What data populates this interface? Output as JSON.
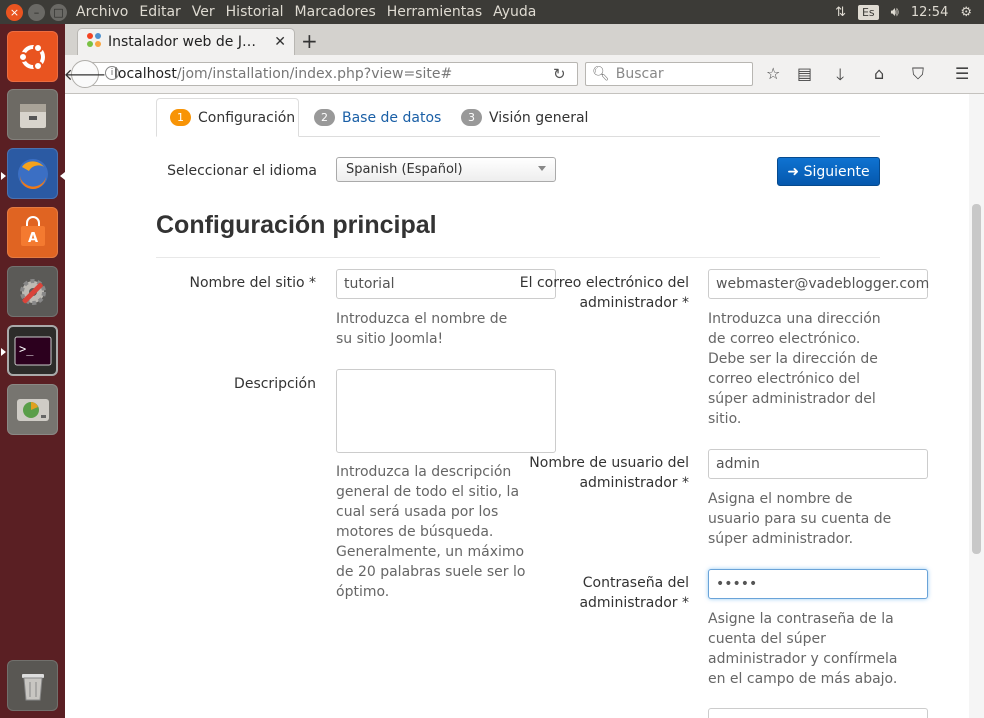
{
  "top_panel": {
    "menu": [
      "Archivo",
      "Editar",
      "Ver",
      "Historial",
      "Marcadores",
      "Herramientas",
      "Ayuda"
    ],
    "language": "Es",
    "time": "12:54",
    "close_glyph": "×",
    "minimize_glyph": "–",
    "maximize_glyph": "□"
  },
  "launcher": {
    "items": [
      "ubuntu-icon",
      "files-icon",
      "firefox-icon",
      "software-center-icon",
      "settings-icon",
      "terminal-icon",
      "disk-icon",
      "trash-icon"
    ]
  },
  "browser": {
    "tab_title": "Instalador web de J…",
    "new_tab": "+",
    "url_host": "localhost",
    "url_path": "/jom/installation/index.php?view=site#",
    "search_placeholder": "Buscar"
  },
  "installer": {
    "steps": [
      {
        "number": "1",
        "label": "Configuración"
      },
      {
        "number": "2",
        "label": "Base de datos"
      },
      {
        "number": "3",
        "label": "Visión general"
      }
    ],
    "language_label": "Seleccionar el idioma",
    "language_value": "Spanish (Español)",
    "next_button": "➜ Siguiente",
    "heading": "Configuración principal",
    "site_name": {
      "label": "Nombre del sitio *",
      "value": "tutorial",
      "help": [
        "Introduzca el nombre de",
        "su sitio Joomla!"
      ]
    },
    "description": {
      "label": "Descripción",
      "value": "",
      "help": [
        "Introduzca la descripción",
        "general de todo el sitio, la",
        "cual será usada por los",
        "motores de búsqueda.",
        "Generalmente, un máximo",
        "de 20 palabras suele ser lo",
        "óptimo."
      ]
    },
    "admin_email": {
      "label": [
        "El correo electrónico del",
        "administrador *"
      ],
      "value": "webmaster@vadeblogger.com",
      "help": [
        "Introduzca una dirección",
        "de correo electrónico.",
        "Debe ser la dirección de",
        "correo electrónico del",
        "súper administrador del",
        "sitio."
      ]
    },
    "admin_user": {
      "label": [
        "Nombre de usuario del",
        "administrador *"
      ],
      "value": "admin",
      "help": [
        "Asigna el nombre de",
        "usuario para su cuenta de",
        "súper administrador."
      ]
    },
    "admin_password": {
      "label": [
        "Contraseña del",
        "administrador *"
      ],
      "value": "•••••",
      "help": [
        "Asigne la contraseña de la",
        "cuenta del súper",
        "administrador y confírmela",
        "en el campo de más abajo."
      ]
    }
  }
}
